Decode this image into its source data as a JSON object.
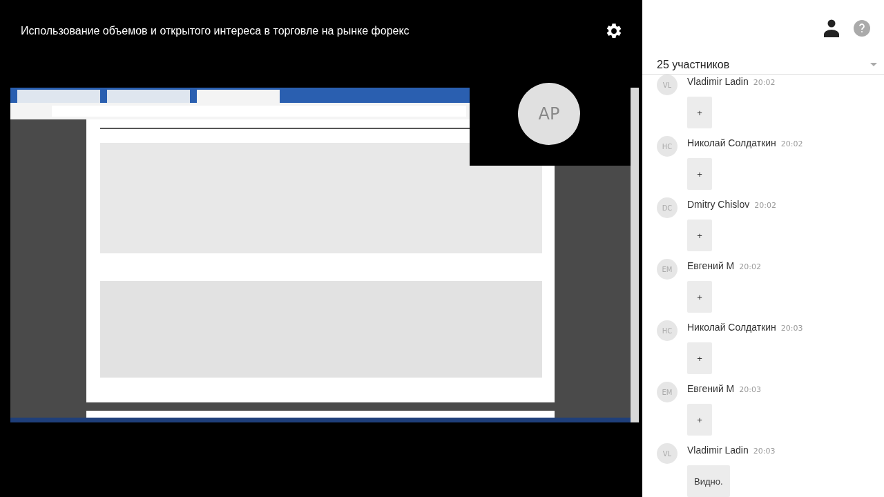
{
  "title": "Использование объемов и открытого интереса в торговле на рынке форекс",
  "presenter": {
    "initials": "AP"
  },
  "participants": {
    "label": "25 участников"
  },
  "messages": [
    {
      "initials": "VL",
      "name": "Vladimir Ladin",
      "time": "20:02",
      "text": "+"
    },
    {
      "initials": "НС",
      "name": "Николай Солдаткин",
      "time": "20:02",
      "text": "+"
    },
    {
      "initials": "DC",
      "name": "Dmitry Chislov",
      "time": "20:02",
      "text": "+"
    },
    {
      "initials": "ЕМ",
      "name": "Евгений М",
      "time": "20:02",
      "text": "+"
    },
    {
      "initials": "НС",
      "name": "Николай Солдаткин",
      "time": "20:03",
      "text": "+"
    },
    {
      "initials": "ЕМ",
      "name": "Евгений М",
      "time": "20:03",
      "text": "+"
    },
    {
      "initials": "VL",
      "name": "Vladimir Ladin",
      "time": "20:03",
      "text": "Видно."
    }
  ]
}
